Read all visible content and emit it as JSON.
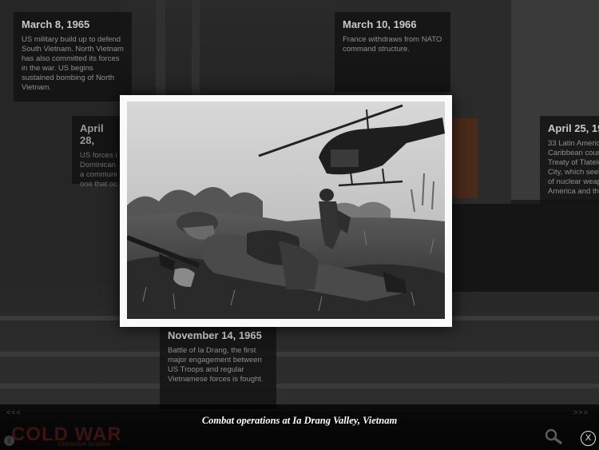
{
  "events": [
    {
      "date": "March 8, 1965",
      "text": "US military build up to defend South Vietnam. North Vietnam has also committed its forces in the war. US begins sustained bombing of North Vietnam."
    },
    {
      "date": "March 10, 1966",
      "text": "France withdraws from NATO command structure."
    },
    {
      "date": "April 28,",
      "text": "US forces i\nDominican \na communi\none that oc"
    },
    {
      "date": "April 25, 19",
      "text": "33 Latin Americ\nCaribbean coun\nTreaty of Tlatelo\nCity, which seek\nof nuclear weap\nAmerica and the"
    },
    {
      "date": "November 14, 1965",
      "text": "Battle of Ia Drang, the first major engagement between US Troops and regular Vietnamese forces is fought."
    }
  ],
  "caption": "Combat operations at Ia Drang Valley, Vietnam",
  "nav": {
    "prev": "<<<",
    "next": ">>>"
  },
  "brand": {
    "title": "COLD WAR",
    "subtitle": "interactive timeline"
  },
  "icons": {
    "info": "i",
    "search": "search-icon",
    "close": "X"
  },
  "colors": {
    "caption": "#ffffff",
    "brand": "#3a1414"
  }
}
